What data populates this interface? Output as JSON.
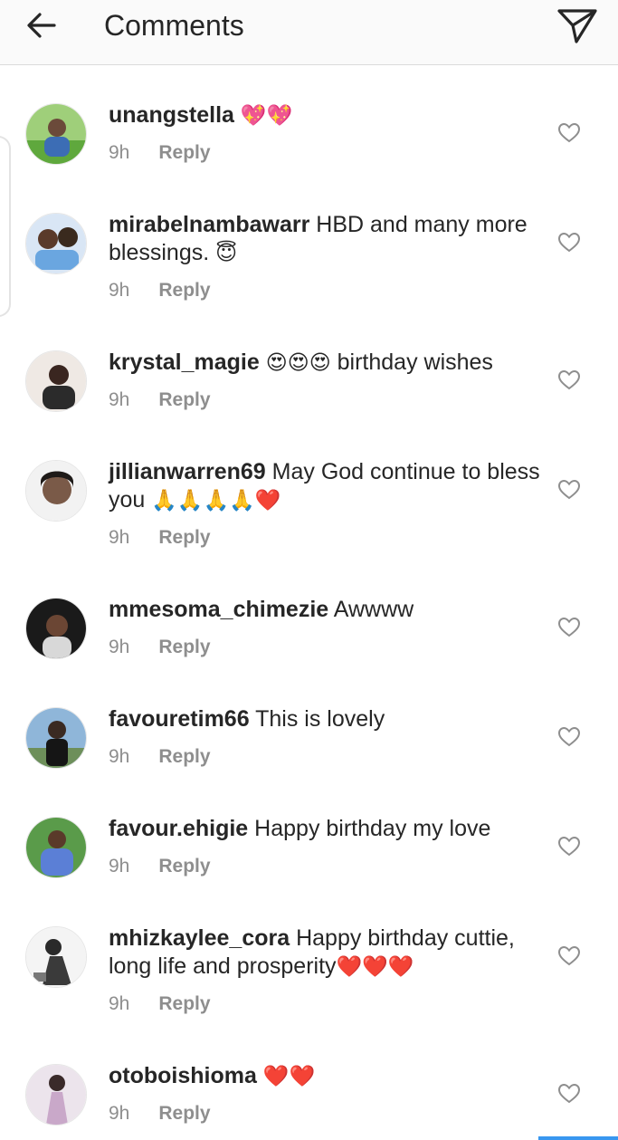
{
  "header": {
    "title": "Comments",
    "back_icon": "arrow-left-icon",
    "share_icon": "direct-send-icon"
  },
  "colors": {
    "text": "#262626",
    "meta": "#8e8e8e",
    "heart": "#ed4956",
    "accent": "#3897f0"
  },
  "reply_label": "Reply",
  "comments": [
    {
      "username": "unangstella",
      "text": "",
      "emoji": "💖💖",
      "time": "9h"
    },
    {
      "username": "mirabelnambawarr",
      "text": "HBD and many more blessings.",
      "emoji": "😇",
      "time": "9h"
    },
    {
      "username": "krystal_magie",
      "text": "birthday wishes",
      "emoji": "😍😍😍",
      "time": "9h"
    },
    {
      "username": "jillianwarren69",
      "text": "May God continue to bless you",
      "emoji": "🙏🙏🙏🙏❤️",
      "time": "9h"
    },
    {
      "username": "mmesoma_chimezie",
      "text": "Awwww",
      "emoji": "",
      "time": "9h"
    },
    {
      "username": "favouretim66",
      "text": "This is lovely",
      "emoji": "",
      "time": "9h"
    },
    {
      "username": "favour.ehigie",
      "text": "Happy birthday my love",
      "emoji": "",
      "time": "9h"
    },
    {
      "username": "mhizkaylee_cora",
      "text": "Happy birthday cuttie, long life and prosperity",
      "emoji": "❤️❤️❤️",
      "time": "9h"
    },
    {
      "username": "otoboishioma",
      "text": "",
      "emoji": "❤️❤️",
      "time": "9h"
    }
  ]
}
